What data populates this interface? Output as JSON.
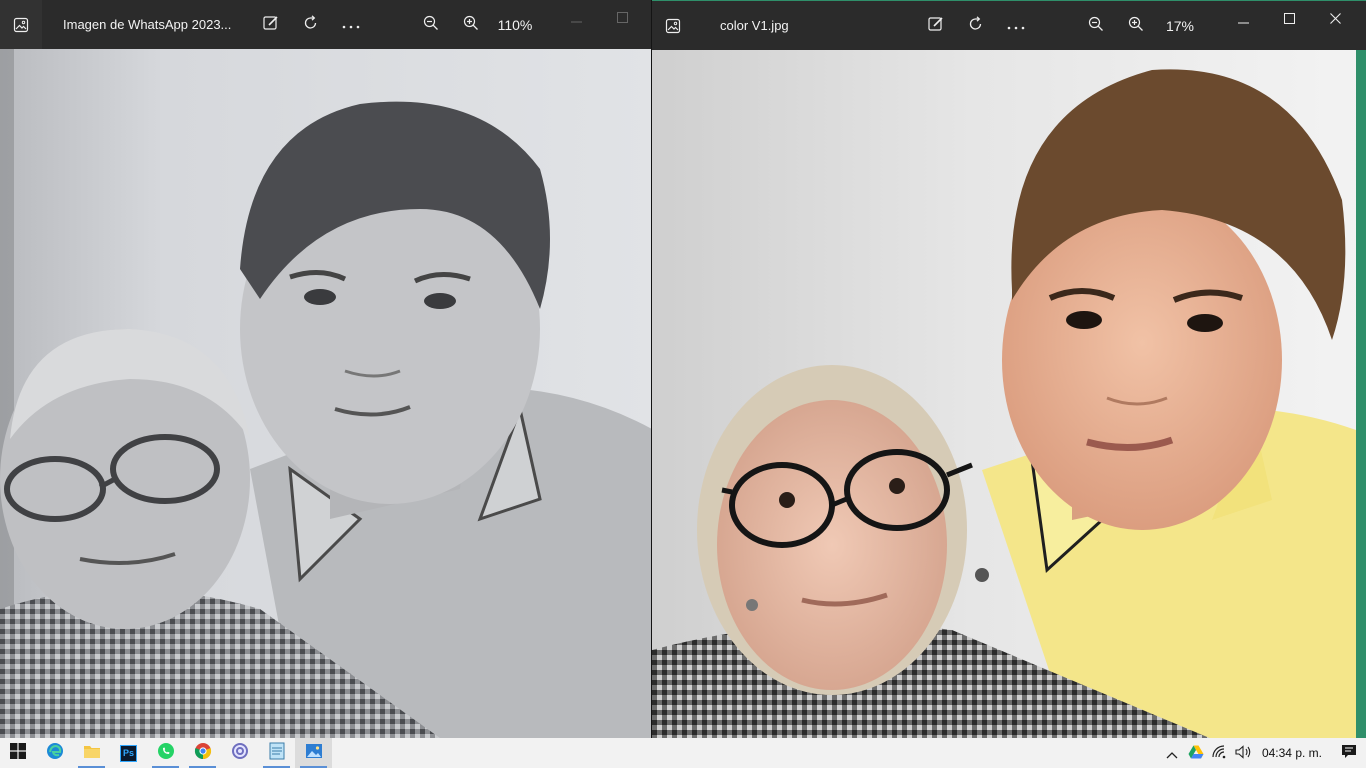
{
  "left_window": {
    "title": "Imagen de WhatsApp 2023...",
    "zoom": "110%",
    "photo": "black-and-white portrait of elderly woman with glasses and young boy"
  },
  "right_window": {
    "title": "color V1.jpg",
    "zoom": "17%",
    "photo": "colorized portrait of elderly woman with glasses and young boy in yellow shirt"
  },
  "taskbar": {
    "apps": [
      "start-icon",
      "edge-icon",
      "file-explorer-icon",
      "photoshop-icon",
      "whatsapp-icon",
      "chrome-icon",
      "browser-icon",
      "notepad-icon",
      "photos-icon"
    ],
    "photoshop_label": "Ps",
    "clock": "04:34 p. m."
  },
  "colors": {
    "titlebar": "#2b2b2b",
    "taskbar": "#f2f2f2",
    "accent": "#2f8f6a"
  }
}
